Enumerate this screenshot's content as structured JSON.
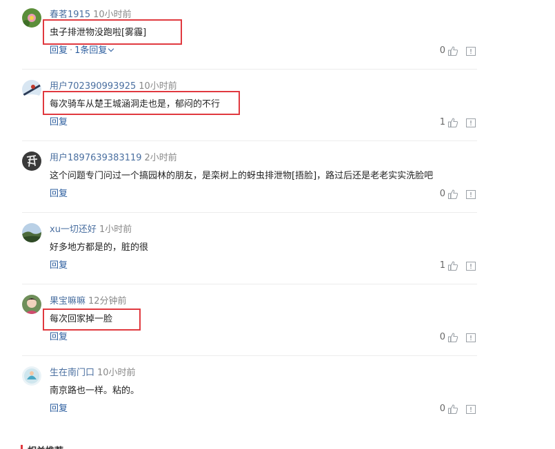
{
  "comments": [
    {
      "user": "春茗1915",
      "time": "10小时前",
      "text": "虫子排泄物没跑啦[雾霾]",
      "reply": "回复",
      "sep": "·",
      "more": "1条回复",
      "likes": "0"
    },
    {
      "user": "用户702390993925",
      "time": "10小时前",
      "text": "每次骑车从楚王城涵洞走也是，郁闷的不行",
      "reply": "回复",
      "likes": "1"
    },
    {
      "user": "用户1897639383119",
      "time": "2小时前",
      "text": "这个问题专门问过一个搞园林的朋友，是栾树上的蚜虫排泄物[捂脸]，路过后还是老老实实洗脸吧",
      "reply": "回复",
      "likes": "0"
    },
    {
      "user": "xu一切还好",
      "time": "1小时前",
      "text": "好多地方都是的，脏的很",
      "reply": "回复",
      "likes": "1"
    },
    {
      "user": "果宝嘛嘛",
      "time": "12分钟前",
      "text": "每次回家掉一脸",
      "reply": "回复",
      "likes": "0"
    },
    {
      "user": "生在南门口",
      "time": "10小时前",
      "text": "南京路也一样。粘的。",
      "reply": "回复",
      "likes": "0"
    }
  ],
  "icons": {
    "like": "thumbs-up-icon",
    "report": "report-icon",
    "more": "chevron-down-icon"
  },
  "colors": {
    "highlight": "#e0383e",
    "link": "#2b5d9e",
    "username": "#4a6fa0"
  },
  "footer": {
    "text": "相关推荐"
  }
}
